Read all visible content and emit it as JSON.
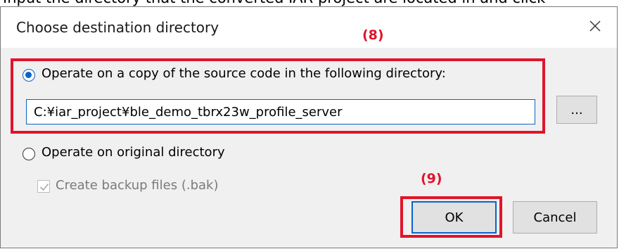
{
  "top_clipped_text": "Input the directory that the converted IAR project are located in and click",
  "dialog": {
    "title": "Choose destination directory",
    "close_icon": "close-icon"
  },
  "options": {
    "copy_label": "Operate on a copy of the source code in the following directory:",
    "copy_selected": true,
    "path_value": "C:¥iar_project¥ble_demo_tbrx23w_profile_server",
    "browse_label": "...",
    "original_label": "Operate on original directory",
    "original_selected": false,
    "backup_label": "Create backup files (.bak)",
    "backup_checked": true,
    "backup_enabled": false
  },
  "buttons": {
    "ok": "OK",
    "cancel": "Cancel"
  },
  "annotations": {
    "step8": "(8)",
    "step9": "(9)",
    "color": "#e0142b"
  },
  "colors": {
    "accent": "#0a64c8",
    "dialog_bg": "#f0f0f0",
    "button_bg": "#e1e1e1"
  }
}
